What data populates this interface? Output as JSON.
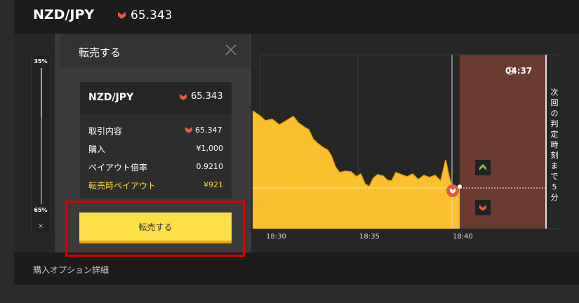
{
  "header": {
    "pair": "NZD/JPY",
    "price": "65.343"
  },
  "gauge": {
    "top_pct": "35%",
    "bottom_pct": "65%",
    "close": "×"
  },
  "timer": {
    "countdown": "04:37"
  },
  "next_judgement_label": "次回の判定時刻まで5分",
  "x_ticks": [
    "18:30",
    "18:35",
    "18:40"
  ],
  "panel": {
    "title": "転売する",
    "card": {
      "pair": "NZD/JPY",
      "price": "65.343",
      "rows": [
        {
          "label": "取引内容",
          "value": "65.347"
        },
        {
          "label": "購入",
          "value": "¥1,000"
        },
        {
          "label": "ペイアウト倍率",
          "value": "0.9210"
        },
        {
          "label": "転売時ペイアウト",
          "value": "¥921"
        }
      ]
    },
    "button": "転売する"
  },
  "bottom": {
    "label": "購入オプション詳細"
  },
  "colors": {
    "accent": "#fde047",
    "area": "#fbc02d",
    "down": "#e25d3d",
    "up": "#8bc34a",
    "expiry_zone": "#6b3a30",
    "highlight": "#e00000"
  },
  "icons": [
    "clock-icon",
    "down-arrow-icon",
    "up-arrow-icon",
    "close-icon"
  ]
}
